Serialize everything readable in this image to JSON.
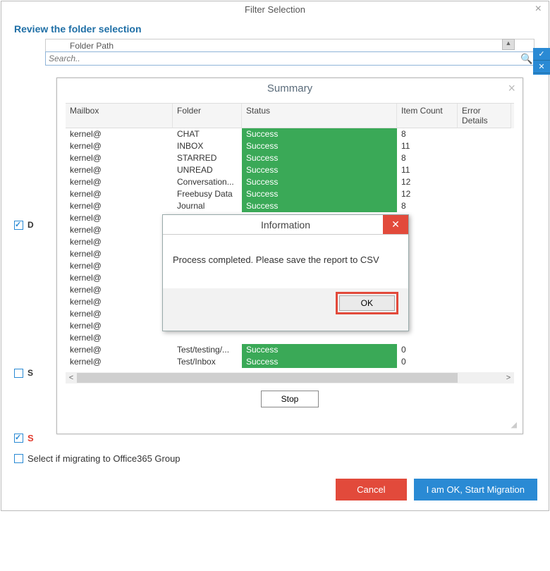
{
  "window": {
    "title": "Filter Selection",
    "close": "×"
  },
  "review": {
    "heading": "Review the folder selection",
    "folder_path_label": "Folder Path",
    "search_placeholder": "Search..",
    "sort_glyph": "▲"
  },
  "sidebar": {
    "checks": [
      {
        "checked": true,
        "label": "D"
      },
      {
        "checked": false,
        "label": "S"
      }
    ]
  },
  "bottom": {
    "row1_checked": true,
    "row1_label_visible": "S",
    "row2_checked": false,
    "row2_label": "Select if migrating to Office365 Group"
  },
  "footer": {
    "cancel": "Cancel",
    "start": "I am OK, Start Migration"
  },
  "summary": {
    "title": "Summary",
    "close": "×",
    "columns": [
      "Mailbox",
      "Folder",
      "Status",
      "Item Count",
      "Error Details"
    ],
    "rows": [
      {
        "mailbox": "kernel@",
        "folder": "CHAT",
        "status": "Success",
        "count": "8",
        "err": ""
      },
      {
        "mailbox": "kernel@",
        "folder": "INBOX",
        "status": "Success",
        "count": "11",
        "err": ""
      },
      {
        "mailbox": "kernel@",
        "folder": "STARRED",
        "status": "Success",
        "count": "8",
        "err": ""
      },
      {
        "mailbox": "kernel@",
        "folder": "UNREAD",
        "status": "Success",
        "count": "11",
        "err": ""
      },
      {
        "mailbox": "kernel@",
        "folder": "Conversation...",
        "status": "Success",
        "count": "12",
        "err": ""
      },
      {
        "mailbox": "kernel@",
        "folder": "Freebusy Data",
        "status": "Success",
        "count": "12",
        "err": ""
      },
      {
        "mailbox": "kernel@",
        "folder": "Journal",
        "status": "Success",
        "count": "8",
        "err": ""
      },
      {
        "mailbox": "kernel@",
        "folder": "",
        "status": "",
        "count": "",
        "err": ""
      },
      {
        "mailbox": "kernel@",
        "folder": "",
        "status": "",
        "count": "",
        "err": ""
      },
      {
        "mailbox": "kernel@",
        "folder": "",
        "status": "",
        "count": "",
        "err": ""
      },
      {
        "mailbox": "kernel@",
        "folder": "",
        "status": "",
        "count": "",
        "err": ""
      },
      {
        "mailbox": "kernel@",
        "folder": "",
        "status": "",
        "count": "",
        "err": ""
      },
      {
        "mailbox": "kernel@",
        "folder": "",
        "status": "",
        "count": "",
        "err": ""
      },
      {
        "mailbox": "kernel@",
        "folder": "",
        "status": "",
        "count": "",
        "err": ""
      },
      {
        "mailbox": "kernel@",
        "folder": "",
        "status": "",
        "count": "",
        "err": ""
      },
      {
        "mailbox": "kernel@",
        "folder": "",
        "status": "",
        "count": "",
        "err": ""
      },
      {
        "mailbox": "kernel@",
        "folder": "",
        "status": "",
        "count": "",
        "err": ""
      },
      {
        "mailbox": "kernel@",
        "folder": "",
        "status": "",
        "count": "",
        "err": ""
      },
      {
        "mailbox": "kernel@",
        "folder": "Test/testing/...",
        "status": "Success",
        "count": "0",
        "err": ""
      },
      {
        "mailbox": "kernel@",
        "folder": "Test/Inbox",
        "status": "Success",
        "count": "0",
        "err": ""
      }
    ],
    "stop": "Stop",
    "scroll_left": "<",
    "scroll_right": ">"
  },
  "info": {
    "title": "Information",
    "close": "✕",
    "message": "Process completed. Please save the report to CSV",
    "ok": "OK"
  },
  "colors": {
    "accent_blue": "#2a8ad4",
    "accent_red": "#e24a3b",
    "success_green": "#3aa957"
  }
}
